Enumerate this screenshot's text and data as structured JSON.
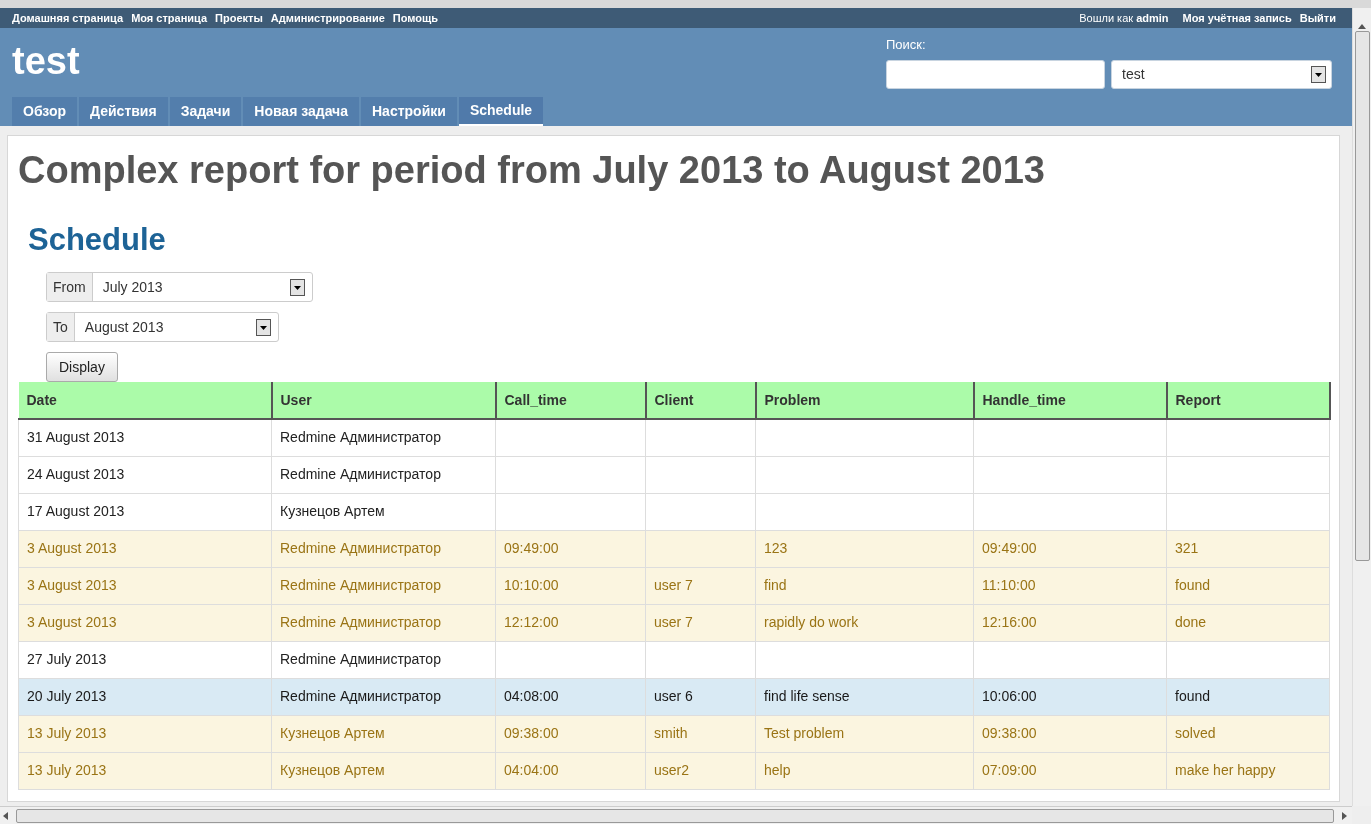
{
  "top_menu": {
    "items": [
      "Домашняя страница",
      "Моя страница",
      "Проекты",
      "Администрирование",
      "Помощь"
    ],
    "logged_in_prefix": "Вошли как",
    "logged_in_user": "admin",
    "account_links": [
      "Моя учётная запись",
      "Выйти"
    ]
  },
  "header": {
    "project_title": "test",
    "search_label": "Поиск:",
    "project_select": {
      "value": "test"
    }
  },
  "tabs": [
    {
      "label": "Обзор",
      "selected": false
    },
    {
      "label": "Действия",
      "selected": false
    },
    {
      "label": "Задачи",
      "selected": false
    },
    {
      "label": "Новая задача",
      "selected": false
    },
    {
      "label": "Настройки",
      "selected": false
    },
    {
      "label": "Schedule",
      "selected": true
    }
  ],
  "page_title": "Complex report for period from July 2013 to August 2013",
  "section_title": "Schedule",
  "filters": [
    {
      "label": "From",
      "value": "July 2013"
    },
    {
      "label": "To",
      "value": "August 2013"
    }
  ],
  "display_button": "Display",
  "table": {
    "columns": [
      "Date",
      "User",
      "Call_time",
      "Client",
      "Problem",
      "Handle_time",
      "Report"
    ],
    "rows": [
      {
        "kind": "blank",
        "selected": false,
        "cells": [
          "31 August 2013",
          "Redmine Администратор",
          "",
          "",
          "",
          "",
          ""
        ]
      },
      {
        "kind": "blank",
        "selected": false,
        "cells": [
          "24 August 2013",
          "Redmine Администратор",
          "",
          "",
          "",
          "",
          ""
        ]
      },
      {
        "kind": "blank",
        "selected": false,
        "cells": [
          "17 August 2013",
          "Кузнецов Артем",
          "",
          "",
          "",
          "",
          ""
        ]
      },
      {
        "kind": "entry",
        "selected": false,
        "cells": [
          "3 August 2013",
          "Redmine Администратор",
          "09:49:00",
          "",
          "123",
          "09:49:00",
          "321"
        ]
      },
      {
        "kind": "entry",
        "selected": false,
        "cells": [
          "3 August 2013",
          "Redmine Администратор",
          "10:10:00",
          "user 7",
          "find",
          "11:10:00",
          "found"
        ]
      },
      {
        "kind": "entry",
        "selected": false,
        "cells": [
          "3 August 2013",
          "Redmine Администратор",
          "12:12:00",
          "user 7",
          "rapidly do work",
          "12:16:00",
          "done"
        ]
      },
      {
        "kind": "blank",
        "selected": false,
        "cells": [
          "27 July 2013",
          "Redmine Администратор",
          "",
          "",
          "",
          "",
          ""
        ]
      },
      {
        "kind": "entry",
        "selected": true,
        "cells": [
          "20 July 2013",
          "Redmine Администратор",
          "04:08:00",
          "user 6",
          "find life sense",
          "10:06:00",
          "found"
        ]
      },
      {
        "kind": "entry",
        "selected": false,
        "cells": [
          "13 July 2013",
          "Кузнецов Артем",
          "09:38:00",
          "smith",
          "Test problem",
          "09:38:00",
          "solved"
        ]
      },
      {
        "kind": "entry",
        "selected": false,
        "cells": [
          "13 July 2013",
          "Кузнецов Артем",
          "04:04:00",
          "user2",
          "help",
          "07:09:00",
          "make her happy"
        ]
      }
    ]
  }
}
